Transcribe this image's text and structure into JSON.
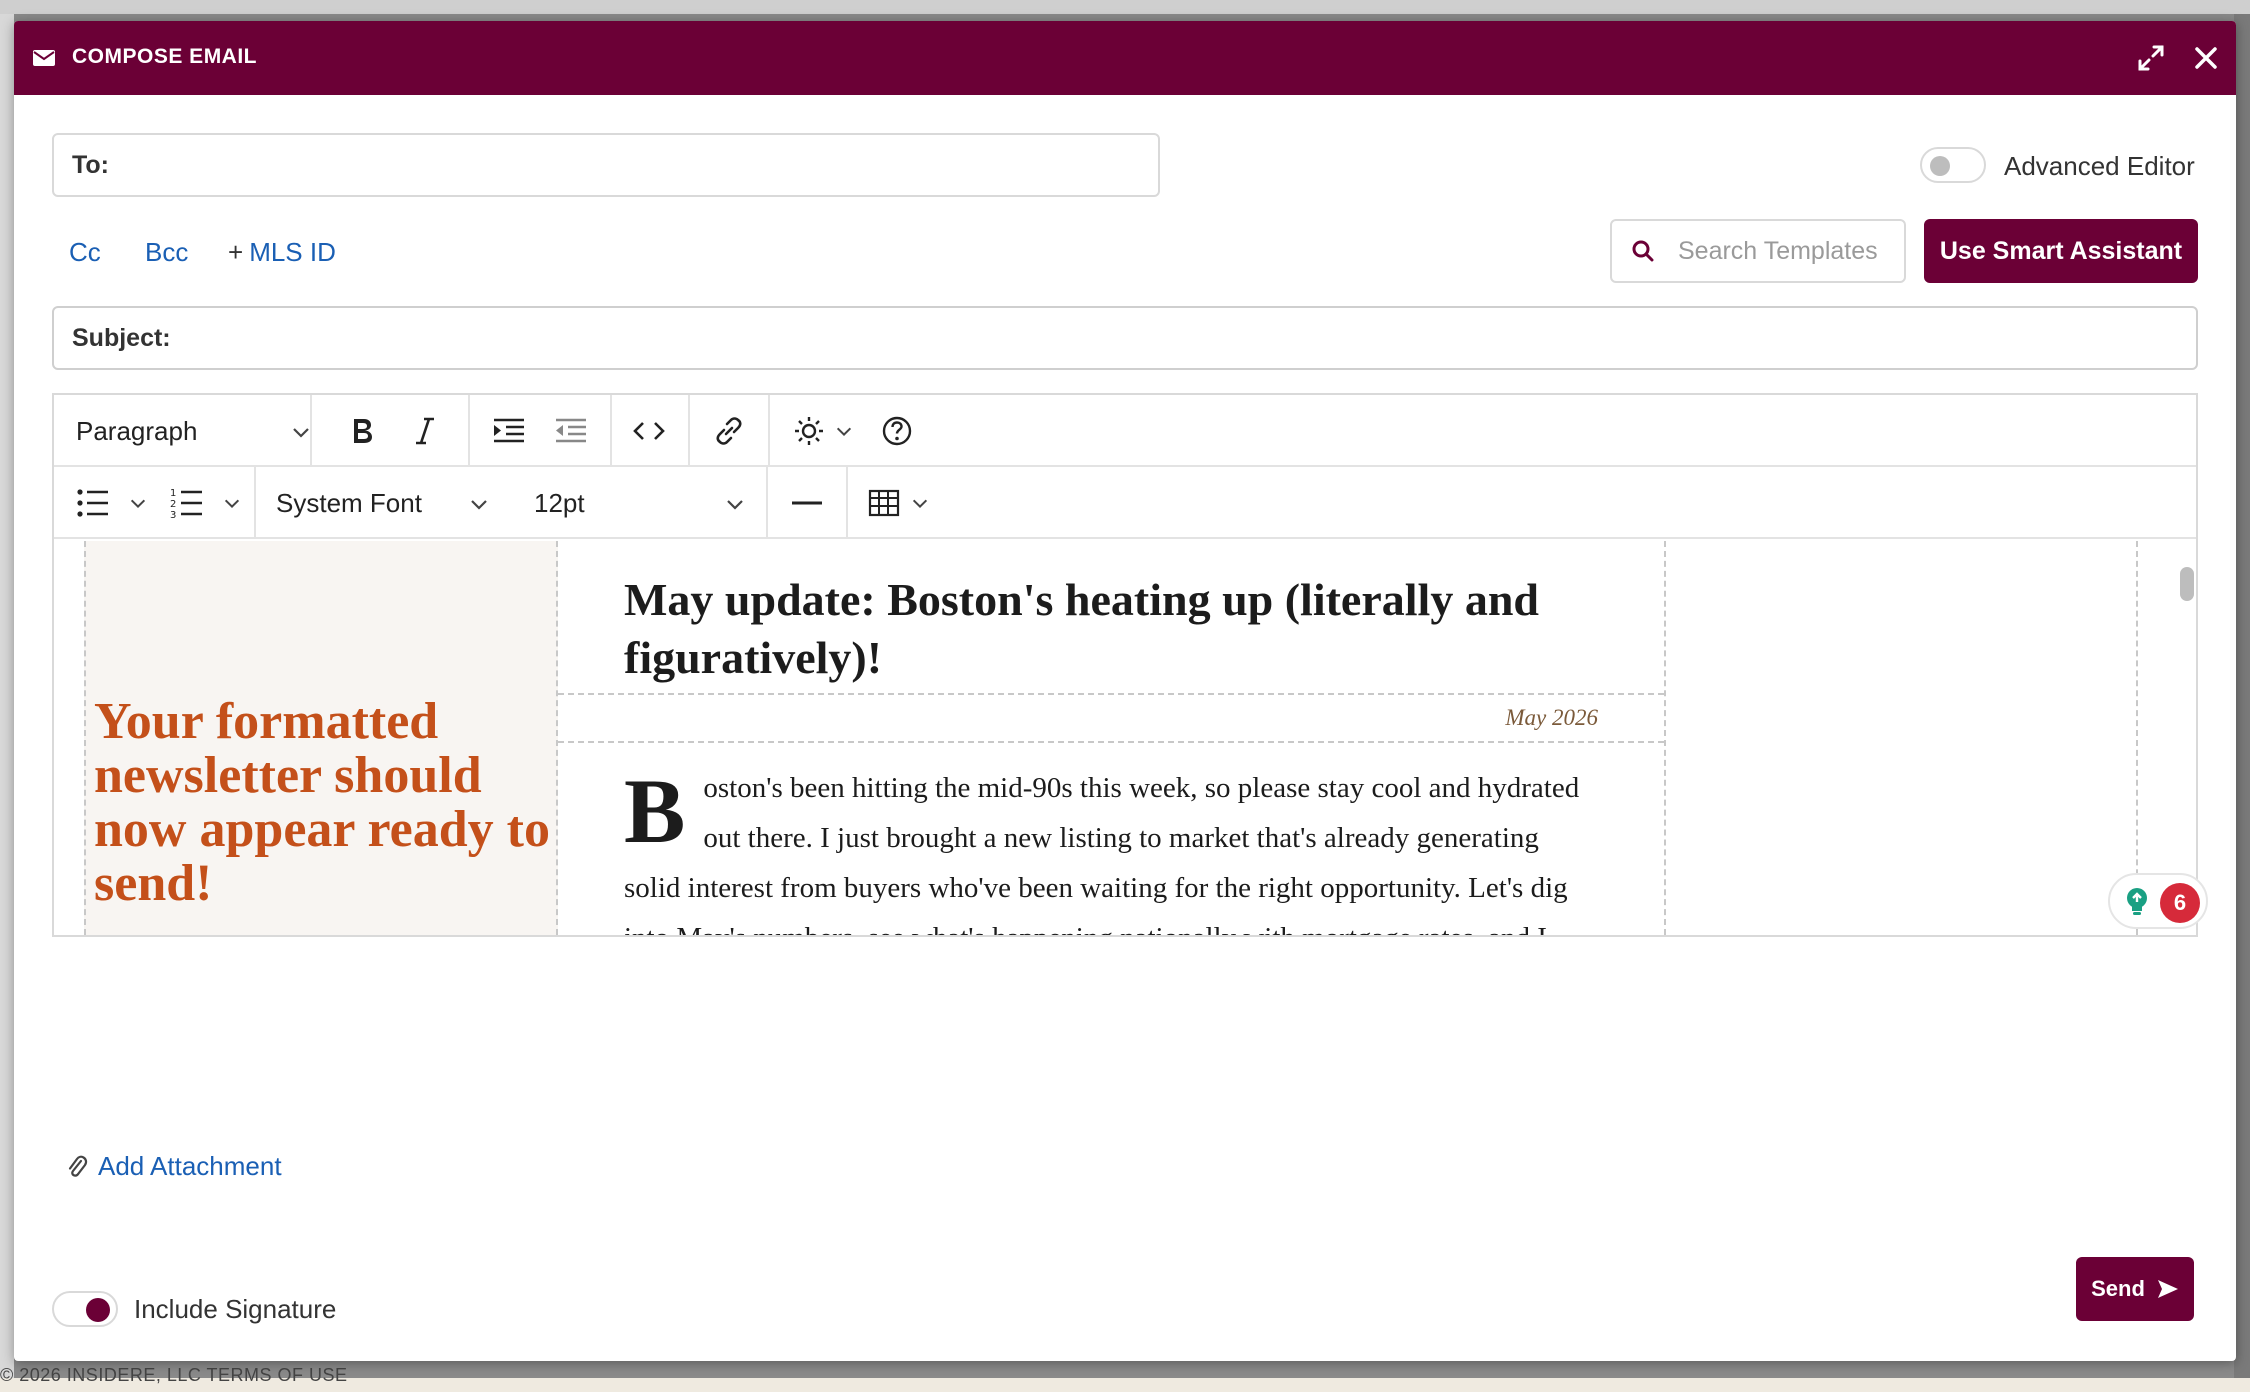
{
  "background": {
    "footer_text": "© 2026 INSIDERE, LLC TERMS OF USE"
  },
  "modal": {
    "title": "COMPOSE EMAIL",
    "icons": {
      "header": "envelope-icon",
      "expand": "expand-icon",
      "close": "close-icon"
    }
  },
  "to": {
    "label": "To:",
    "value": ""
  },
  "advanced_editor": {
    "label": "Advanced Editor",
    "enabled": false
  },
  "links": {
    "cc": "Cc",
    "bcc": "Bcc",
    "mls_plus": "+",
    "mls": "MLS ID"
  },
  "templates": {
    "placeholder": "Search Templates"
  },
  "smart_assistant": {
    "label": "Use Smart Assistant"
  },
  "subject": {
    "label": "Subject:",
    "value": ""
  },
  "toolbar": {
    "block_format": "Paragraph",
    "font_family": "System Font",
    "font_size": "12pt"
  },
  "newsletter": {
    "promo": "Your formatted newsletter should now appear ready to send!",
    "title": "May update: Boston's heating up (literally and figuratively)!",
    "date": "May 2026",
    "dropcap": "B",
    "body": "oston's been hitting the mid-90s this week, so please stay cool and hydrated out there. I just brought a new listing to market that's already generating solid interest from buyers who've been waiting for the right opportunity. Let's dig into May's numbers, see what's happening nationally with mortgage rates, and I found an interesting piece about Boston's changing neighborhood dynamics."
  },
  "grammar": {
    "count": "6"
  },
  "attachment": {
    "label": "Add Attachment"
  },
  "signature": {
    "label": "Include Signature",
    "enabled": true
  },
  "send": {
    "label": "Send"
  },
  "colors": {
    "brand": "#6b0036",
    "link": "#1a5fb4",
    "promo": "#c4501a",
    "badge": "#d62a3a"
  }
}
